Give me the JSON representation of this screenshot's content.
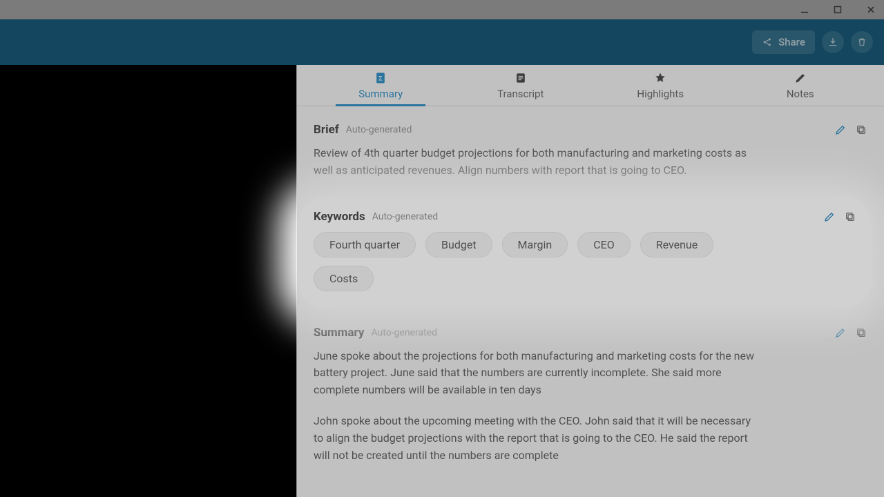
{
  "window": {
    "minimize": "minimize",
    "maximize": "maximize",
    "close": "close"
  },
  "toolbar": {
    "share_label": "Share"
  },
  "tabs": [
    {
      "id": "summary",
      "label": "Summary",
      "active": true
    },
    {
      "id": "transcript",
      "label": "Transcript",
      "active": false
    },
    {
      "id": "highlights",
      "label": "Highlights",
      "active": false
    },
    {
      "id": "notes",
      "label": "Notes",
      "active": false
    }
  ],
  "brief": {
    "title": "Brief",
    "subtitle": "Auto-generated",
    "text": "Review of 4th quarter budget projections for both manufacturing and marketing costs as well as anticipated revenues. Align numbers with report that is going to CEO."
  },
  "keywords": {
    "title": "Keywords",
    "subtitle": "Auto-generated",
    "items": [
      "Fourth quarter",
      "Budget",
      "Margin",
      "CEO",
      "Revenue",
      "Costs"
    ]
  },
  "summary": {
    "title": "Summary",
    "subtitle": "Auto-generated",
    "paragraphs": [
      "June spoke about the projections for both manufacturing and marketing costs for the new battery project. June said that the numbers are currently incomplete. She said more complete numbers will be available in ten days",
      "John spoke about the upcoming meeting with the CEO. John said that it will be necessary to align the budget projections with the report that is going to the CEO. He said the report will not be created until the numbers are complete"
    ]
  }
}
